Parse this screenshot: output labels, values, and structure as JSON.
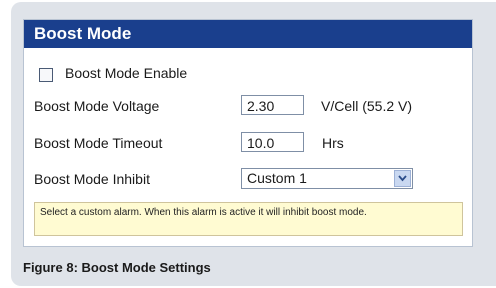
{
  "panel": {
    "title": "Boost Mode",
    "enable": {
      "label": "Boost Mode Enable",
      "checked": false
    },
    "voltage": {
      "label": "Boost Mode Voltage",
      "value": "2.30",
      "unit": "V/Cell (55.2 V)"
    },
    "timeout": {
      "label": "Boost Mode Timeout",
      "value": "10.0",
      "unit": "Hrs"
    },
    "inhibit": {
      "label": "Boost Mode Inhibit",
      "selected": "Custom 1"
    },
    "hint": "Select a custom alarm. When this alarm is active it will inhibit boost mode."
  },
  "caption": "Figure 8: Boost Mode Settings",
  "colors": {
    "header": "#1a3f8d",
    "frame": "#dfe3e9",
    "hint_bg": "#fffbd2"
  }
}
